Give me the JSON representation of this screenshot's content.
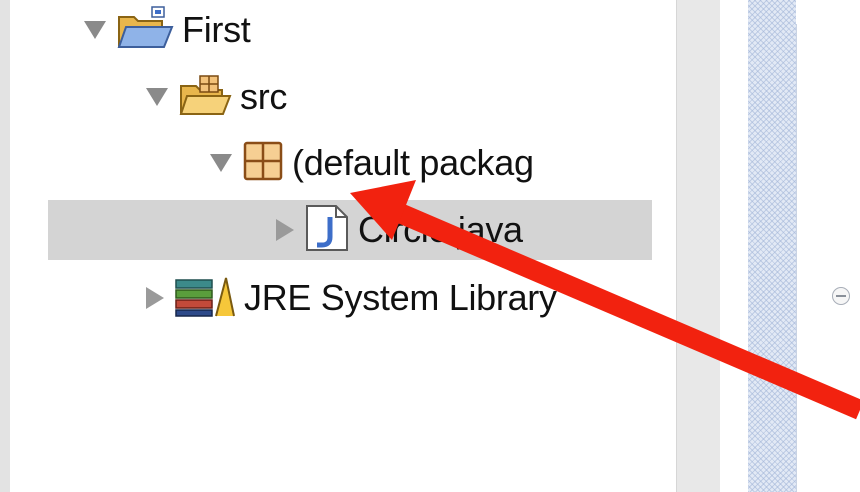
{
  "tree": {
    "project": {
      "label": "First"
    },
    "src": {
      "label": "src"
    },
    "package": {
      "label": "(default packag"
    },
    "file": {
      "label": "Circle.java"
    },
    "library": {
      "label": "JRE System Library"
    }
  },
  "colors": {
    "selection": "#d4d4d4",
    "arrow": "#f2220f",
    "folder": "#f2c86a",
    "java_blue": "#3d6ec9"
  }
}
